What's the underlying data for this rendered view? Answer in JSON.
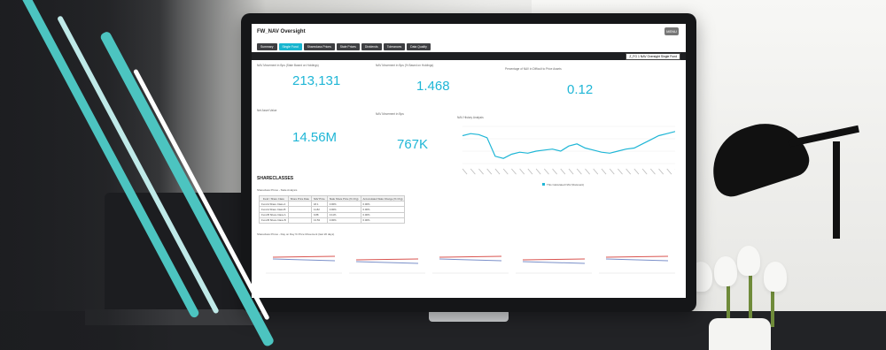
{
  "app": {
    "title": "FW_NAV Oversight",
    "header_button": "MENU",
    "tabs": [
      {
        "label": "Summary",
        "active": false
      },
      {
        "label": "Single Fund",
        "active": true
      },
      {
        "label": "Shareclass Prices",
        "active": false
      },
      {
        "label": "Stale Prices",
        "active": false
      },
      {
        "label": "Dividends",
        "active": false
      },
      {
        "label": "Tolerances",
        "active": false
      },
      {
        "label": "Data Quality",
        "active": false
      }
    ],
    "dropdown_value": "Z_FG 1 NAV Oversight Single Fund"
  },
  "kpis": [
    {
      "label": "NAV Movement in Bps (Stale Based on Holdings)",
      "value": "213,131"
    },
    {
      "label": "NAV Movement in Bps (% Based on Holdings)",
      "value": "1.468"
    },
    {
      "label": "Percentage of NAV in Difficult to Price Assets",
      "value": "0.12"
    },
    {
      "label": "Net Asset Value",
      "value": "14.56M"
    },
    {
      "label": "NAV Movement in Bps",
      "value": "767K"
    }
  ],
  "nav_history": {
    "title": "NAV History Analysis",
    "legend": "This Calculated NAV (Relevant)",
    "color": "#1fb6d6",
    "values": [
      60,
      62,
      61,
      58,
      40,
      38,
      42,
      44,
      43,
      45,
      46,
      47,
      45,
      50,
      52,
      48,
      46,
      44,
      43,
      45,
      47,
      48,
      52,
      56,
      60,
      62,
      64
    ]
  },
  "shareclasses": {
    "title": "SHARECLASSES",
    "subtitle": "Shareclass Prices - Stale Analysis",
    "table": {
      "headers": [
        "Fund / Share Class",
        "Share Price Date",
        "NAV Price",
        "Stale Share Price (% Chg)",
        "Accumulated Stale Change (% Chg)"
      ],
      "rows": [
        [
          "Fund A Share Class A",
          "",
          "18.1",
          "0.00%",
          "0.00%"
        ],
        [
          "Fund A Share Class B",
          "",
          "11.82",
          "0.00%",
          "0.00%"
        ],
        [
          "Fund B Share Class A",
          "",
          "9.88",
          "0.11%",
          "0.00%"
        ],
        [
          "Fund B Share Class B",
          "",
          "13.53",
          "0.00%",
          "0.00%"
        ]
      ]
    },
    "chart_subtitle": "Shareclass Prices - Day on Day % Price Movement (last 20 days)"
  },
  "movement_chart": {
    "series_colors": [
      "#d9534f",
      "#7a8fc9"
    ],
    "segments": 5
  },
  "decor": {
    "stripe_colors": [
      "#4cc4c0",
      "#bfe9e8",
      "#ffffff"
    ]
  }
}
